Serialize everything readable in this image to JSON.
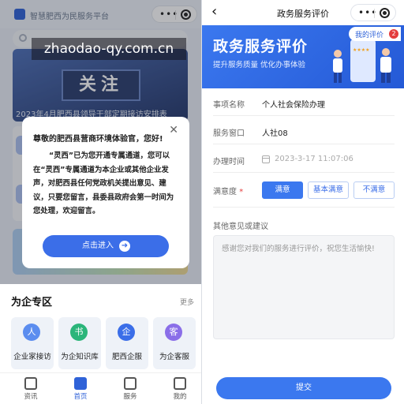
{
  "left_screen": {
    "app_title": "智慧肥西为民服务平台",
    "capsule": {
      "more_glyph": "•••"
    },
    "banner": {
      "sign_text": "关注",
      "caption": "2023年4月肥西县领导干部定期接访安排表"
    },
    "modal": {
      "greeting": "尊敬的肥西县营商环境体验官，您好!",
      "body": "“灵西”已为您开通专属通道，您可以在“灵西”专属通道为本企业或其他企业发声，对肥西县任何党政机关提出意见、建议，只要您留言，县委县政府会第一时间为您处理，欢迎留言。",
      "close_glyph": "✕",
      "enter_label": "点击进入",
      "enter_arrow": "➜"
    },
    "section": {
      "title": "为企专区",
      "more": "更多",
      "services": [
        {
          "label": "企业家接访",
          "icon": "person-icon",
          "color": "#5b8def",
          "glyph": "人"
        },
        {
          "label": "为企知识库",
          "icon": "book-icon",
          "color": "#2bb57a",
          "glyph": "书"
        },
        {
          "label": "肥西企服",
          "icon": "building-icon",
          "color": "#3b6ee8",
          "glyph": "企"
        },
        {
          "label": "为企客服",
          "icon": "headset-icon",
          "color": "#8a6ee8",
          "glyph": "客"
        }
      ]
    },
    "tabbar": [
      {
        "label": "资讯",
        "active": false
      },
      {
        "label": "首页",
        "active": true
      },
      {
        "label": "服务",
        "active": false
      },
      {
        "label": "我的",
        "active": false
      }
    ]
  },
  "watermark": "zhaodao-qy.com.cn",
  "right_screen": {
    "nav_title": "政务服务评价",
    "back_glyph": "‹",
    "capsule": {
      "more_glyph": "•••"
    },
    "hero": {
      "title": "政务服务评价",
      "subtitle": "提升服务质量  优化办事体验",
      "my_reviews_label": "我的评价",
      "my_reviews_count": "2"
    },
    "form": {
      "item_label": "事项名称",
      "item_value": "个人社会保险办理",
      "window_label": "服务窗口",
      "window_value": "人社08",
      "time_label": "办理时间",
      "time_value": "2023-3-17 11:07:06",
      "satisfaction_label": "满意度",
      "required_mark": "*",
      "satisfaction_options": [
        "满意",
        "基本满意",
        "不满意"
      ],
      "selected_option": "满意",
      "comment_label": "其他意见或建议",
      "comment_placeholder": "感谢您对我们的服务进行评价，祝您生活愉快!",
      "submit_label": "提交"
    }
  },
  "colors": {
    "accent": "#3b78ef",
    "badge": "#e43d3d"
  }
}
